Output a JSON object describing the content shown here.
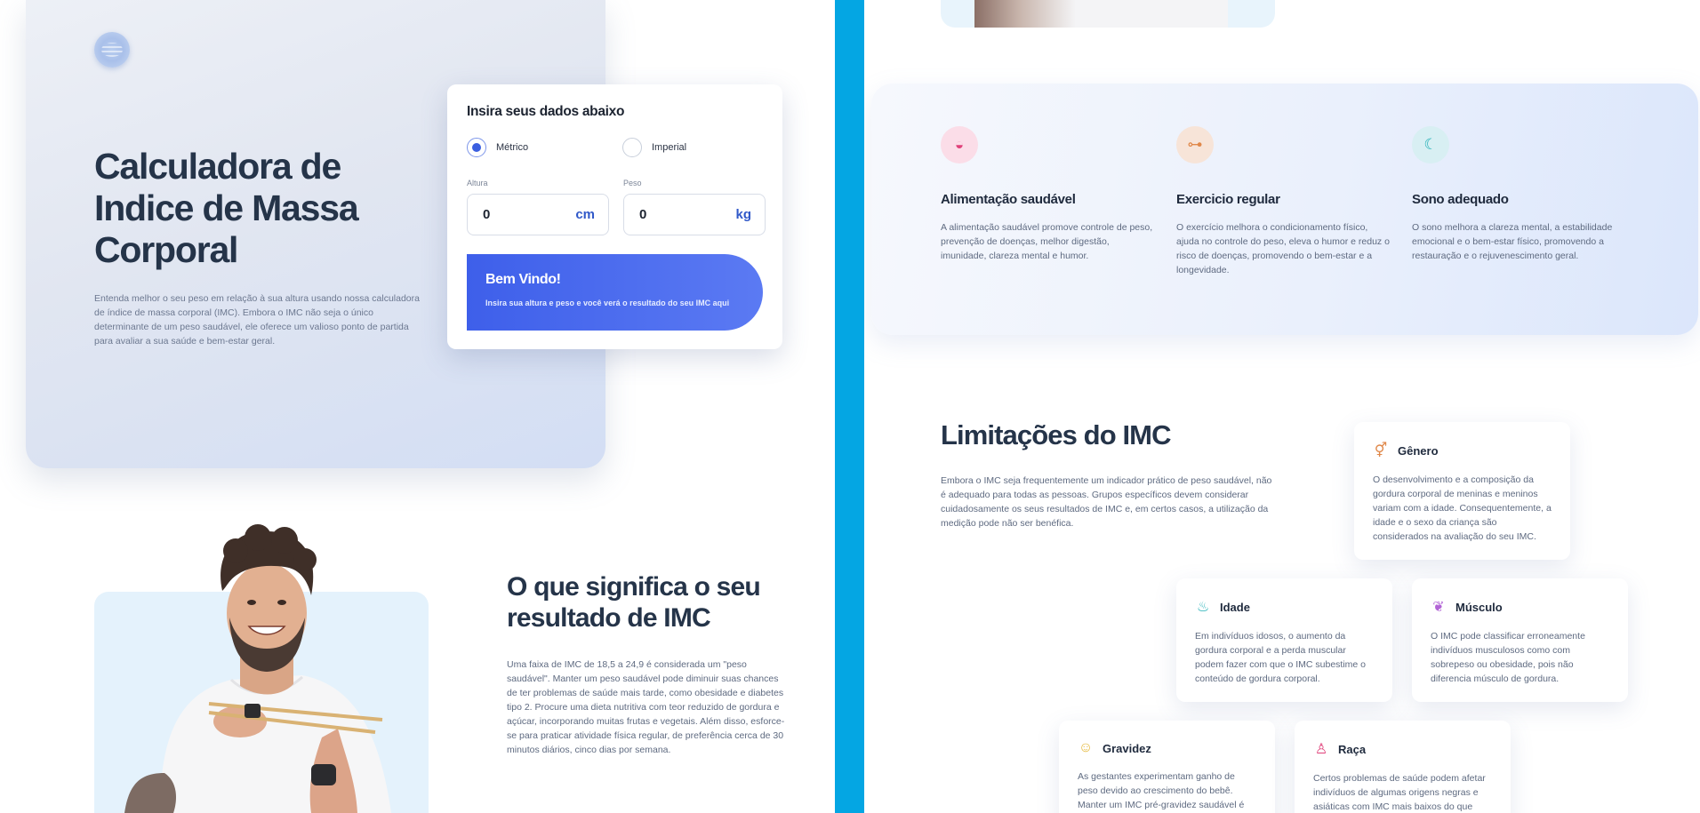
{
  "hero": {
    "title": "Calculadora de Indice de Massa Corporal",
    "description": "Entenda melhor o seu peso em relação à sua altura usando nossa calculadora de índice de massa corporal (IMC). Embora o IMC não seja o único determinante de um peso saudável, ele oferece um valioso ponto de partida para avaliar a sua saúde e bem-estar geral."
  },
  "form": {
    "title": "Insira seus dados abaixo",
    "options": [
      "Métrico",
      "Imperial"
    ],
    "selected": "Métrico",
    "height": {
      "label": "Altura",
      "value": "0",
      "unit": "cm"
    },
    "weight": {
      "label": "Peso",
      "value": "0",
      "unit": "kg"
    },
    "welcome": {
      "title": "Bem Vindo!",
      "subtitle": "Insira sua altura e peso e você verá o resultado do seu IMC aqui"
    }
  },
  "meaning": {
    "title": "O que significa o seu resultado de IMC",
    "description": "Uma faixa de IMC de 18,5 a 24,9 é considerada um \"peso saudável\". Manter um peso saudável pode diminuir suas chances de ter problemas de saúde mais tarde, como obesidade e diabetes tipo 2. Procure uma dieta nutritiva com teor reduzido de gordura e açúcar, incorporando muitas frutas e vegetais. Além disso, esforce-se para praticar atividade física regular, de preferência cerca de 30 minutos diários, cinco dias por semana."
  },
  "benefits": [
    {
      "icon": "bowl-icon",
      "glyph": "◒",
      "color": "#e0417a",
      "bg": "#fbdde8",
      "title": "Alimentação saudável",
      "description": "A alimentação saudável promove controle de peso, prevenção de doenças, melhor digestão, imunidade, clareza mental e humor."
    },
    {
      "icon": "dumbbell-icon",
      "glyph": "⊶",
      "color": "#e0884a",
      "bg": "#f7e4d8",
      "title": "Exercicio regular",
      "description": "O exercício melhora o condicionamento físico, ajuda no controle do peso, eleva o humor e reduz o risco de doenças, promovendo o bem-estar e a longevidade."
    },
    {
      "icon": "moon-icon",
      "glyph": "☾",
      "color": "#27b2b8",
      "bg": "#d8eff3",
      "title": "Sono adequado",
      "description": "O sono melhora a clareza mental, a estabilidade emocional e o bem-estar físico, promovendo a restauração e o rejuvenescimento geral."
    }
  ],
  "limitations": {
    "title": "Limitações do IMC",
    "description": "Embora o IMC seja frequentemente um indicador prático de peso saudável, não é adequado para todas as pessoas. Grupos específicos devem considerar cuidadosamente os seus resultados de IMC e, em certos casos, a utilização da medição pode não ser benéfica.",
    "cards": [
      {
        "icon": "gender-icon",
        "glyph": "⚥",
        "color": "#e0884a",
        "title": "Gênero",
        "description": "O desenvolvimento e a composição da gordura corporal de meninas e meninos variam com a idade. Consequentemente, a idade e o sexo da criança são considerados na avaliação do seu IMC."
      },
      {
        "icon": "cake-icon",
        "glyph": "♨",
        "color": "#27b2b8",
        "title": "Idade",
        "description": "Em indivíduos idosos, o aumento da gordura corporal e a perda muscular podem fazer com que o IMC subestime o conteúdo de gordura corporal."
      },
      {
        "icon": "muscle-icon",
        "glyph": "❦",
        "color": "#b264d6",
        "title": "Músculo",
        "description": "O IMC pode classificar erroneamente indivíduos musculosos como com sobrepeso ou obesidade, pois não diferencia músculo de gordura."
      },
      {
        "icon": "pregnancy-icon",
        "glyph": "☺",
        "color": "#e5b83a",
        "title": "Gravidez",
        "description": "As gestantes experimentam ganho de peso devido ao crescimento do bebê. Manter um IMC pré-gravidez saudável é"
      },
      {
        "icon": "race-icon",
        "glyph": "♙",
        "color": "#e0417a",
        "title": "Raça",
        "description": "Certos problemas de saúde podem afetar indivíduos de algumas origens negras e asiáticas com IMC mais baixos do que"
      }
    ]
  },
  "colors": {
    "accent": "#3b5fe0",
    "divider": "#04a6e3",
    "heading": "#253449"
  }
}
